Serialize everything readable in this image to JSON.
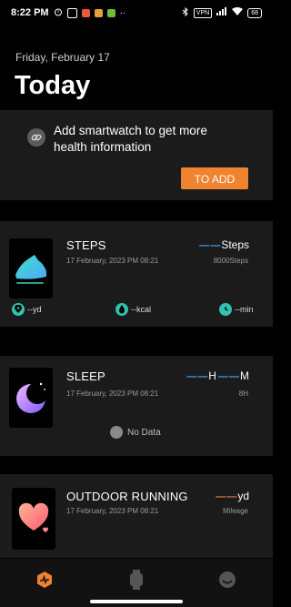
{
  "status_bar": {
    "time": "8:22 PM",
    "more_dots": "··",
    "vpn_label": "VPN",
    "battery_label": "68"
  },
  "header": {
    "date": "Friday, February 17",
    "title": "Today"
  },
  "promo": {
    "text": "Add smartwatch to get more health information",
    "button_label": "TO ADD",
    "icon": "link-icon"
  },
  "steps": {
    "title": "STEPS",
    "date": "17 February, 2023 PM 08:21",
    "value_dash": "— —",
    "unit": "Steps",
    "goal": "8000Steps",
    "stats": [
      {
        "icon": "location-icon",
        "label": "--yd"
      },
      {
        "icon": "flame-icon",
        "label": "--kcal"
      },
      {
        "icon": "clock-icon",
        "label": "--min"
      }
    ]
  },
  "sleep": {
    "title": "SLEEP",
    "date": "17 February, 2023 PM 08:21",
    "hour_dash": "— —",
    "hour_unit": "H",
    "min_dash": "— —",
    "min_unit": "M",
    "goal": "8H",
    "no_data": "No Data"
  },
  "running": {
    "title": "OUTDOOR RUNNING",
    "date": "17 February, 2023 PM 08:21",
    "value_dash": "— —",
    "unit": "yd",
    "sub": "Mileage"
  },
  "colors": {
    "accent": "#f0832f",
    "blue": "#4fa8f7",
    "orange_dash": "#f07a4a",
    "card": "#1b1b1b"
  },
  "nav": [
    {
      "icon": "activity-icon",
      "active": true
    },
    {
      "icon": "watch-icon",
      "active": false
    },
    {
      "icon": "profile-icon",
      "active": false
    }
  ]
}
